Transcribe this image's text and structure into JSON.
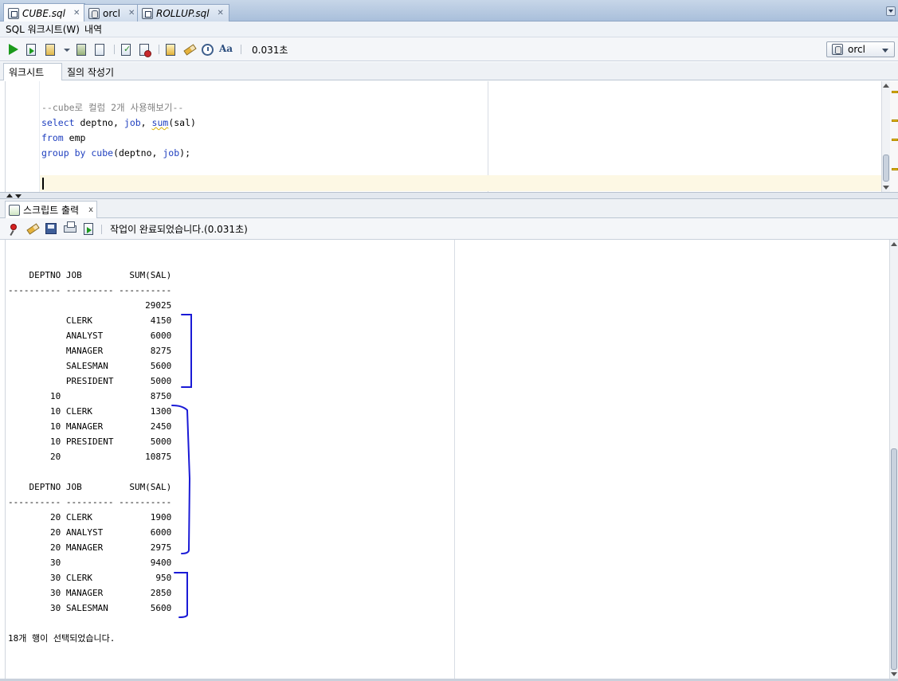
{
  "document_tabs": [
    {
      "label": "CUBE.sql",
      "icon": "sql-file-icon",
      "italic": true,
      "active": true
    },
    {
      "label": "orcl",
      "icon": "database-connection-icon",
      "italic": false,
      "active": false
    },
    {
      "label": "ROLLUP.sql",
      "icon": "sql-file-icon",
      "italic": true,
      "active": false
    }
  ],
  "subtabs": [
    "SQL 워크시트(W)",
    "내역"
  ],
  "toolbar": {
    "timing": "0.031초",
    "connection": "orcl"
  },
  "worksheet_tabs": [
    "워크시트",
    "질의 작성기"
  ],
  "editor": {
    "line1": "--cube로 컬럼 2개 사용해보기--",
    "line2_kw": "select",
    "line2_a": "deptno",
    "line2_b": "job",
    "line2_fn": "sum",
    "line2_arg": "(sal)",
    "line3_kw": "from",
    "line3_id": "emp",
    "line4_kw1": "group",
    "line4_kw2": "by",
    "line4_fn": "cube",
    "line4_args_a": "(deptno, ",
    "line4_args_b": "job",
    "line4_args_c": ");"
  },
  "output": {
    "tab_label": "스크립트 출력",
    "status": "작업이 완료되었습니다.(0.031초)",
    "header": [
      "DEPTNO",
      "JOB",
      "SUM(SAL)"
    ],
    "rows_page1": [
      {
        "deptno": "",
        "job": "",
        "sum": "29025"
      },
      {
        "deptno": "",
        "job": "CLERK",
        "sum": "4150"
      },
      {
        "deptno": "",
        "job": "ANALYST",
        "sum": "6000"
      },
      {
        "deptno": "",
        "job": "MANAGER",
        "sum": "8275"
      },
      {
        "deptno": "",
        "job": "SALESMAN",
        "sum": "5600"
      },
      {
        "deptno": "",
        "job": "PRESIDENT",
        "sum": "5000"
      },
      {
        "deptno": "10",
        "job": "",
        "sum": "8750"
      },
      {
        "deptno": "10",
        "job": "CLERK",
        "sum": "1300"
      },
      {
        "deptno": "10",
        "job": "MANAGER",
        "sum": "2450"
      },
      {
        "deptno": "10",
        "job": "PRESIDENT",
        "sum": "5000"
      },
      {
        "deptno": "20",
        "job": "",
        "sum": "10875"
      }
    ],
    "rows_page2": [
      {
        "deptno": "20",
        "job": "CLERK",
        "sum": "1900"
      },
      {
        "deptno": "20",
        "job": "ANALYST",
        "sum": "6000"
      },
      {
        "deptno": "20",
        "job": "MANAGER",
        "sum": "2975"
      },
      {
        "deptno": "30",
        "job": "",
        "sum": "9400"
      },
      {
        "deptno": "30",
        "job": "CLERK",
        "sum": "950"
      },
      {
        "deptno": "30",
        "job": "MANAGER",
        "sum": "2850"
      },
      {
        "deptno": "30",
        "job": "SALESMAN",
        "sum": "5600"
      }
    ],
    "footer": "18개 행이 선택되었습니다."
  },
  "colors": {
    "keyword": "#1f3fbf",
    "comment": "#808080",
    "annotation_bracket": "#1a1ad6"
  }
}
